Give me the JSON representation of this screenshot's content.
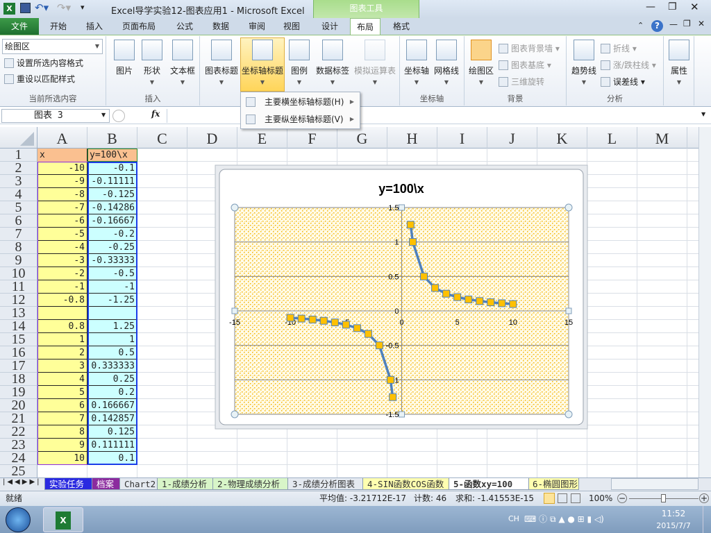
{
  "window": {
    "title": "Excel导学实验12-图表应用1  -  Microsoft Excel",
    "context_tab_group": "图表工具"
  },
  "ribbon_tabs": [
    "文件",
    "开始",
    "插入",
    "页面布局",
    "公式",
    "数据",
    "审阅",
    "视图",
    "设计",
    "布局",
    "格式"
  ],
  "active_tab": "布局",
  "ribbon": {
    "current_selection": {
      "dropdown_value": "绘图区",
      "format_selection": "设置所选内容格式",
      "reset_style": "重设以匹配样式",
      "label": "当前所选内容"
    },
    "insert": {
      "picture": "图片",
      "shapes": "形状",
      "textbox": "文本框",
      "label": "插入"
    },
    "labels": {
      "chart_title": "图表标题",
      "axis_titles": "坐标轴标题",
      "legend": "图例",
      "data_labels": "数据标签",
      "data_table": "模拟运算表"
    },
    "axes": {
      "axes": "坐标轴",
      "gridlines": "网格线",
      "label": "坐标轴"
    },
    "background": {
      "plot_area": "绘图区",
      "chart_wall": "图表背景墙",
      "chart_floor": "图表基底",
      "rotation_3d": "三维旋转",
      "label": "背景"
    },
    "analysis": {
      "trendline": "趋势线",
      "lines": "折线",
      "updown_bars": "涨/跌柱线",
      "error_bars": "误差线",
      "label": "分析"
    },
    "properties": {
      "label": "属性"
    }
  },
  "axis_titles_menu": [
    "主要横坐标轴标题(H)",
    "主要纵坐标轴标题(V)"
  ],
  "formula_bar": {
    "name_box": "图表 3",
    "fx": "fx",
    "formula": ""
  },
  "columns": [
    "A",
    "B",
    "C",
    "D",
    "E",
    "F",
    "G",
    "H",
    "I",
    "J",
    "K",
    "L",
    "M"
  ],
  "rows": [
    "1",
    "2",
    "3",
    "4",
    "5",
    "6",
    "7",
    "8",
    "9",
    "10",
    "11",
    "12",
    "13",
    "14",
    "15",
    "16",
    "17",
    "18",
    "19",
    "20",
    "21",
    "22",
    "23",
    "24",
    "25"
  ],
  "cells": {
    "A": [
      "x",
      "-10",
      "-9",
      "-8",
      "-7",
      "-6",
      "-5",
      "-4",
      "-3",
      "-2",
      "-1",
      "-0.8",
      "",
      "0.8",
      "1",
      "2",
      "3",
      "4",
      "5",
      "6",
      "7",
      "8",
      "9",
      "10"
    ],
    "B": [
      "y=100\\x",
      "-0.1",
      "-0.11111",
      "-0.125",
      "-0.14286",
      "-0.16667",
      "-0.2",
      "-0.25",
      "-0.33333",
      "-0.5",
      "-1",
      "-1.25",
      "",
      "1.25",
      "1",
      "0.5",
      "0.333333",
      "0.25",
      "0.2",
      "0.166667",
      "0.142857",
      "0.125",
      "0.111111",
      "0.1"
    ]
  },
  "chart_data": {
    "type": "scatter",
    "title": "y=100\\x",
    "xlim": [
      -15,
      15
    ],
    "ylim": [
      -1.5,
      1.5
    ],
    "xticks": [
      "-15",
      "-10",
      "-5",
      "0",
      "5",
      "10",
      "15"
    ],
    "yticks": [
      "1.5",
      "1",
      "0.5",
      "0",
      "-0.5",
      "-1",
      "-1.5"
    ],
    "grid": true,
    "legend": "none",
    "line_color": "#4f81bd",
    "marker_color": "#ffc000",
    "plot_bg": "pattern-dots-orange",
    "x": [
      -10,
      -9,
      -8,
      -7,
      -6,
      -5,
      -4,
      -3,
      -2,
      -1,
      -0.8,
      null,
      0.8,
      1,
      2,
      3,
      4,
      5,
      6,
      7,
      8,
      9,
      10
    ],
    "y": [
      -0.1,
      -0.11111,
      -0.125,
      -0.14286,
      -0.16667,
      -0.2,
      -0.25,
      -0.33333,
      -0.5,
      -1,
      -1.25,
      null,
      1.25,
      1,
      0.5,
      0.333333,
      0.25,
      0.2,
      0.166667,
      0.142857,
      0.125,
      0.111111,
      0.1
    ]
  },
  "sheet_tabs": [
    {
      "label": "实验任务",
      "color": "#2a2ae0"
    },
    {
      "label": "档案",
      "color": "#8b2b9e"
    },
    {
      "label": "Chart2",
      "color": ""
    },
    {
      "label": "1-成绩分析",
      "color": "#d8f5c8"
    },
    {
      "label": "2-物理成绩分析",
      "color": "#d8f5c8"
    },
    {
      "label": "3-成绩分析图表",
      "color": ""
    },
    {
      "label": "4-SIN函数COS函数",
      "color": "#ffffb0"
    },
    {
      "label": "5-函数xy=100",
      "color": "#ffffff"
    },
    {
      "label": "6-椭圆图形",
      "color": "#ffffb0"
    }
  ],
  "active_sheet": "5-函数xy=100",
  "status": {
    "ready": "就绪",
    "average": "平均值: -3.21712E-17",
    "count": "计数: 46",
    "sum": "求和: -1.41553E-15",
    "zoom": "100%",
    "zoom_fraction": 0.5
  },
  "taskbar": {
    "lang": "CH",
    "time": "11:52",
    "date": "2015/7/7"
  }
}
